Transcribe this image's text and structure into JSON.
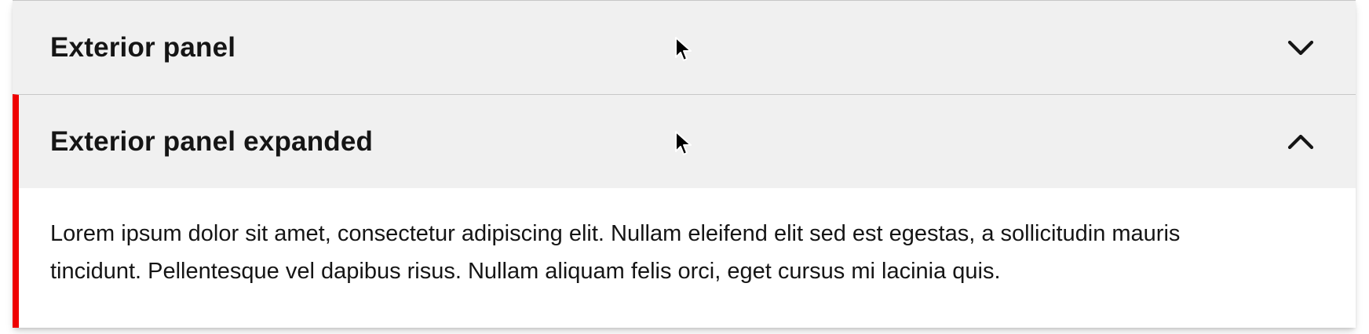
{
  "accordion": {
    "panels": [
      {
        "title": "Exterior panel",
        "expanded": false,
        "icon": "chevron-down-icon"
      },
      {
        "title": "Exterior panel expanded",
        "expanded": true,
        "icon": "chevron-up-icon",
        "body": "Lorem ipsum dolor sit amet, consectetur adipiscing elit. Nullam eleifend elit sed est egestas, a sollicitudin mauris tincidunt. Pellentesque vel dapibus risus. Nullam aliquam felis orci, eget cursus mi lacinia quis."
      }
    ]
  },
  "colors": {
    "accent_bar": "#ee0000",
    "header_bg": "#f0f0f0",
    "body_bg": "#ffffff",
    "text": "#151515"
  }
}
